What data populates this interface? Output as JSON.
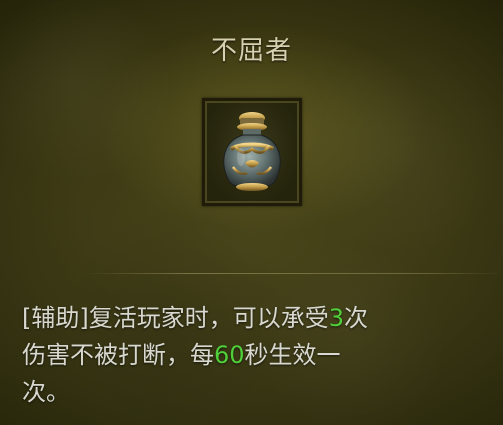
{
  "tooltip": {
    "title": "不屈者",
    "icon": "urn-icon",
    "description": {
      "line1_prefix": "[辅助]复活玩家时，可以承受",
      "hits": "3",
      "line1_suffix": "次",
      "line2_prefix": "伤害不被打断，每",
      "seconds": "60",
      "line2_suffix": "秒生效一",
      "line3": "次。"
    }
  },
  "colors": {
    "highlight_number": "#4fcf3a",
    "title_text": "#d6d0b0",
    "body_text": "#d8d8d0",
    "background": "#3a3814"
  }
}
